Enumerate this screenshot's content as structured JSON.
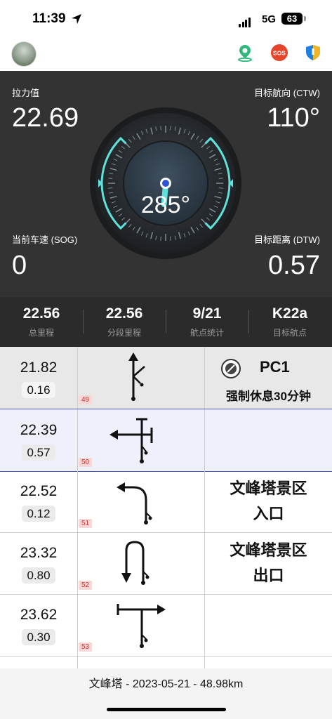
{
  "status": {
    "time": "11:39",
    "network": "5G",
    "battery": "63"
  },
  "topbar": {
    "icons": [
      "map-pin-icon",
      "sos-icon",
      "shield-icon"
    ],
    "colors": {
      "map": "#2fb87a",
      "sos": "#e5452b",
      "shield": "#1f7fe0"
    }
  },
  "dashboard": {
    "pull_label": "拉力值",
    "pull_value": "22.69",
    "ctw_label": "目标航向 (CTW)",
    "ctw_value": "110°",
    "sog_label": "当前车速 (SOG)",
    "sog_value": "0",
    "dtw_label": "目标距离 (DTW)",
    "dtw_value": "0.57",
    "heading": "285°",
    "accent": "#5fe0d8"
  },
  "stats": [
    {
      "value": "22.56",
      "label": "总里程"
    },
    {
      "value": "22.56",
      "label": "分段里程"
    },
    {
      "value": "9/21",
      "label": "航点统计"
    },
    {
      "value": "K22a",
      "label": "目标航点"
    }
  ],
  "rows": [
    {
      "dist": "21.82",
      "seg": "0.16",
      "idx": "49",
      "title": "PC1",
      "note": "强制休息30分钟"
    },
    {
      "dist": "22.39",
      "seg": "0.57",
      "idx": "50",
      "note": ""
    },
    {
      "dist": "22.52",
      "seg": "0.12",
      "idx": "51",
      "note1": "文峰塔景区",
      "note2": "入口"
    },
    {
      "dist": "23.32",
      "seg": "0.80",
      "idx": "52",
      "note1": "文峰塔景区",
      "note2": "出口"
    },
    {
      "dist": "23.62",
      "seg": "0.30",
      "idx": "53",
      "note": ""
    }
  ],
  "footer": {
    "text": "文峰塔 - 2023-05-21 - 48.98km"
  }
}
